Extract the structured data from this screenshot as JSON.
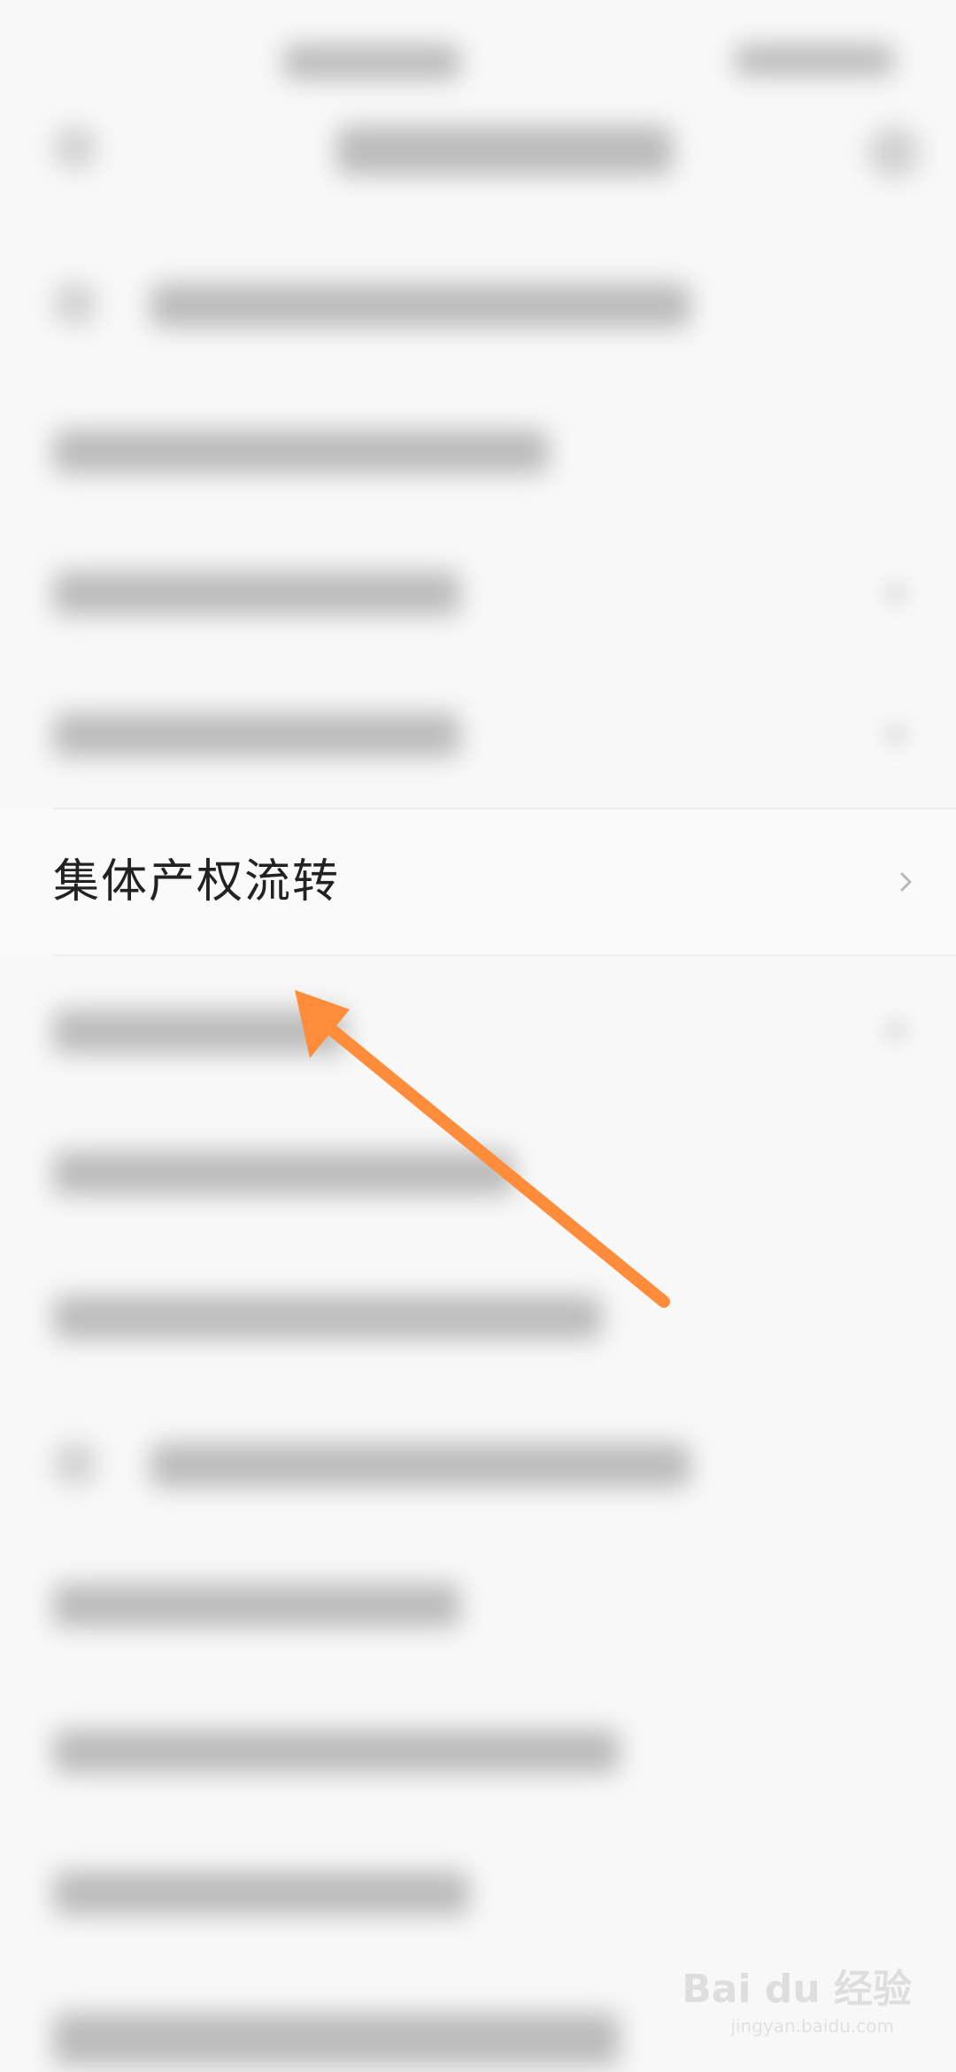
{
  "list": {
    "highlighted_item": {
      "label": "集体产权流转",
      "icon": "chevron-right-icon"
    }
  },
  "annotation": {
    "arrow_color": "#ff8c3a",
    "icon": "pointer-arrow"
  },
  "watermark": {
    "brand": "Bai du 经验",
    "site": "jingyan.baidu.com"
  },
  "colors": {
    "background": "#f8f8f8",
    "text": "#222222",
    "chevron": "#b8b8b8",
    "arrow": "#ff8c3a"
  }
}
